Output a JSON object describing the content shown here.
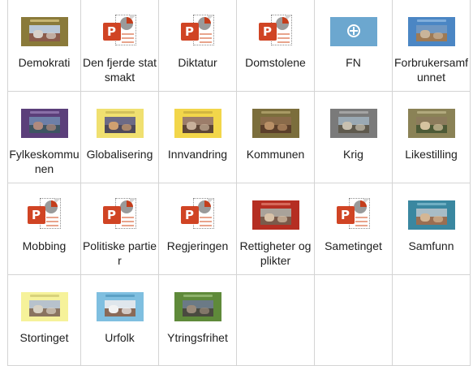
{
  "rows": [
    [
      {
        "label": "Demokrati",
        "kind": "slide",
        "bg": "#8a7a3a",
        "bar": "#e8d690",
        "sky": "#b9c7d6",
        "ground": "#8b5b4b",
        "accent": "#d8d0c8"
      },
      {
        "label": "Den fjerde statsmakt",
        "kind": "ppt"
      },
      {
        "label": "Diktatur",
        "kind": "ppt"
      },
      {
        "label": "Domstolene",
        "kind": "ppt"
      },
      {
        "label": "FN",
        "kind": "un",
        "bg": "#6ca7cf"
      },
      {
        "label": "Forbrukersamfunnet",
        "kind": "slide",
        "bg": "#4b86c4",
        "bar": "#9ec3e8",
        "sky": "#6f97c2",
        "ground": "#9e7a55",
        "accent": "#c9b49a"
      }
    ],
    [
      {
        "label": "Fylkeskommunen",
        "kind": "slide",
        "bg": "#5b3f7a",
        "bar": "#a58bc2",
        "sky": "#6d7fa8",
        "ground": "#3e5562",
        "accent": "#b08a7e"
      },
      {
        "label": "Globalisering",
        "kind": "slide",
        "bg": "#f0e070",
        "bar": "#c2b050",
        "sky": "#6c6a86",
        "ground": "#4f4a5a",
        "accent": "#d0a070"
      },
      {
        "label": "Innvandring",
        "kind": "slide",
        "bg": "#f2d64a",
        "bar": "#c0a63a",
        "sky": "#9c7d6a",
        "ground": "#5e4636",
        "accent": "#c8b09a"
      },
      {
        "label": "Kommunen",
        "kind": "slide",
        "bg": "#7b6e3c",
        "bar": "#c0b27a",
        "sky": "#8a6b4a",
        "ground": "#5b3f2a",
        "accent": "#b99067"
      },
      {
        "label": "Krig",
        "kind": "slide",
        "bg": "#7a7a7a",
        "bar": "#bcbcbc",
        "sky": "#9aa9b4",
        "ground": "#5f5a4e",
        "accent": "#c8c0b0"
      },
      {
        "label": "Likestilling",
        "kind": "slide",
        "bg": "#8a8256",
        "bar": "#c6bf92",
        "sky": "#8c7b5c",
        "ground": "#4d5a36",
        "accent": "#d6c3a0"
      }
    ],
    [
      {
        "label": "Mobbing",
        "kind": "ppt"
      },
      {
        "label": "Politiske partier",
        "kind": "ppt"
      },
      {
        "label": "Regjeringen",
        "kind": "ppt"
      },
      {
        "label": "Rettigheter og plikter",
        "kind": "slide",
        "bg": "#b52e22",
        "bar": "#e8887a",
        "sky": "#a9a29a",
        "ground": "#7a5a4a",
        "accent": "#d8c2a8"
      },
      {
        "label": "Sametinget",
        "kind": "ppt"
      },
      {
        "label": "Samfunn",
        "kind": "slide",
        "bg": "#3a87a0",
        "bar": "#8cc4d6",
        "sky": "#a8bcc6",
        "ground": "#9a6e52",
        "accent": "#d4b694"
      }
    ],
    [
      {
        "label": "Stortinget",
        "kind": "slide",
        "bg": "#f6f29a",
        "bar": "#c8c06a",
        "sky": "#b7c2cc",
        "ground": "#8a7460",
        "accent": "#d8d2c4"
      },
      {
        "label": "Urfolk",
        "kind": "slide",
        "bg": "#7fbfe0",
        "bar": "#4a90b8",
        "sky": "#dfe6ec",
        "ground": "#8a6a58",
        "accent": "#f2f2f2"
      },
      {
        "label": "Ytringsfrihet",
        "kind": "slide",
        "bg": "#5f8a3a",
        "bar": "#a6c886",
        "sky": "#6b7a86",
        "ground": "#4a4a40",
        "accent": "#9a8a7a"
      },
      {
        "kind": "empty"
      },
      {
        "kind": "empty"
      },
      {
        "kind": "empty"
      }
    ]
  ]
}
